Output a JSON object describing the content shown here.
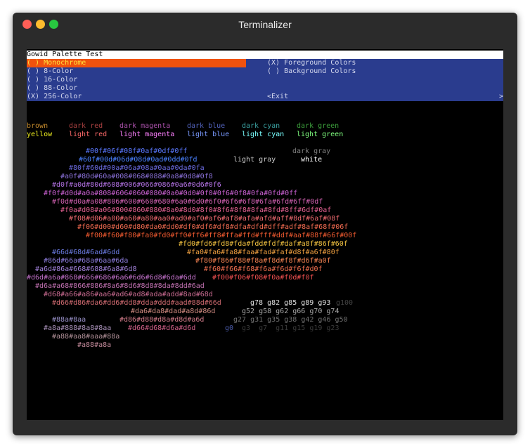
{
  "window": {
    "title": "Terminalizer"
  },
  "header": {
    "title": "Gowid Palette Test"
  },
  "radios_left": [
    {
      "text": "( ) Monochrome",
      "selected": true
    },
    {
      "text": "( ) 8-Color",
      "selected": false
    },
    {
      "text": "( ) 16-Color",
      "selected": false
    },
    {
      "text": "( ) 88-Color",
      "selected": false
    },
    {
      "text": "(X) 256-Color",
      "selected": false
    }
  ],
  "radios_right": [
    {
      "text": "(X) Foreground Colors"
    },
    {
      "text": "( ) Background Colors"
    }
  ],
  "exit_label": "<Exit",
  "scroll_indicator": ">",
  "named_colors": {
    "row1": [
      {
        "text": "brown",
        "color": "#c48a2c"
      },
      {
        "text": "dark red",
        "color": "#a84040"
      },
      {
        "text": "dark magenta",
        "color": "#a850a8"
      },
      {
        "text": "dark blue",
        "color": "#5060b8"
      },
      {
        "text": "dark cyan",
        "color": "#3aa0a0"
      },
      {
        "text": "dark green",
        "color": "#3a9a3a"
      }
    ],
    "row2": [
      {
        "text": "yellow",
        "color": "#f0f020"
      },
      {
        "text": "light red",
        "color": "#ff6a6a"
      },
      {
        "text": "light magenta",
        "color": "#ff80ff"
      },
      {
        "text": "light blue",
        "color": "#7a9aff"
      },
      {
        "text": "light cyan",
        "color": "#7affff"
      },
      {
        "text": "light green",
        "color": "#80ff80"
      }
    ],
    "gray_labels": [
      {
        "text": "dark gray",
        "color": "#808080"
      },
      {
        "text": "light gray",
        "color": "#c8c8c8"
      },
      {
        "text": "white",
        "color": "#ffffff"
      }
    ]
  },
  "palette_lines": [
    {
      "text": "#00f#06f#08f#0af#0df#0ff",
      "color": "#5a78ff"
    },
    {
      "text": "#60f#00d#06d#08d#0ad#0dd#0fd",
      "color": "#4a80ff"
    },
    {
      "text": "#80f#60d#00a#06a#08a#0aa#0da#0fa",
      "color": "#6a6ae0"
    },
    {
      "text": "#a0f#80d#60a#008#068#088#0a8#0d8#0f8",
      "color": "#8a70d8"
    },
    {
      "text": "#d0f#a0d#80d#608#006#066#086#0a6#0d6#0f6",
      "color": "#b070e0"
    },
    {
      "text": "#f0f#d0d#a0a#808#606#060#080#0a0#0d0#0f0#0f6#0f8#0fa#0fd#0ff",
      "color": "#c860d0"
    },
    {
      "text": "#f0d#d0a#a08#806#600#660#680#6a0#6d0#6f0#6f6#6f8#6fa#6fd#6ff#0df",
      "color": "#d060b0"
    },
    {
      "text": "#f0a#d08#a06#800#860#880#8a0#8d0#8f0#8f6#8f8#8fa#8fd#8ff#6df#0af",
      "color": "#e06090"
    },
    {
      "text": "#f08#d06#a00#a60#a80#aa0#ad0#af0#af6#af8#afa#afd#aff#8df#6af#08f",
      "color": "#f06a70"
    },
    {
      "text": "#f06#d00#d60#d80#da0#dd0#df0#df6#df8#dfa#dfd#dff#adf#8af#68f#06f",
      "color": "#f06a50"
    },
    {
      "text": "#f00#f60#f80#fa0#fd0#ff0#ff6#ff8#ffa#ffd#fff#ddf#aaf#88f#66f#00f",
      "color": "#f05a30"
    },
    {
      "text": "#fd0#fd6#fd8#fda#fdd#fdf#daf#a8f#86f#60f",
      "color": "#f0c040"
    },
    {
      "text": "#66d#68d#6ad#6dd",
      "color": "#6a7ae0"
    },
    {
      "text": "#fa0#fa6#fa8#faa#fad#faf#d8f#a6f#80f",
      "color": "#f0a040"
    },
    {
      "text": "#86d#66a#68a#6aa#6da",
      "color": "#8a7ad8"
    },
    {
      "text": "#f80#f86#f88#f8a#f8d#f8f#d6f#a0f",
      "color": "#f08050"
    },
    {
      "text": "#a6d#86a#668#688#6a8#6d8",
      "color": "#a080d8"
    },
    {
      "text": "#f60#f66#f68#f6a#f6d#f6f#d0f",
      "color": "#f07050"
    },
    {
      "text": "#d6d#a6a#868#666#686#6a6#6d6#6d8#6da#6dd",
      "color": "#c070c8"
    },
    {
      "text": "#f00#f06#f08#f0a#f0d#f0f",
      "color": "#f05050"
    },
    {
      "text": "#d6a#a68#866#886#8a6#8d6#8d8#8da#8dd#6ad",
      "color": "#c070b0"
    },
    {
      "text": "#d68#a66#a86#aa6#ad6#ad8#ada#add#8ad#68d",
      "color": "#c86a90"
    },
    {
      "text": "#d66#d86#da6#dd6#dd8#dda#ddd#aad#88d#66d",
      "color": "#d06a70"
    },
    {
      "text": "#da6#da8#dad#a8d#86d",
      "color": "#d08a80"
    },
    {
      "text": "#88a#8aa",
      "color": "#9890c8"
    },
    {
      "text": "#d86#d88#d8a#d8d#a6d",
      "color": "#d07a88"
    },
    {
      "text": "#a8a#888#8a8#8aa",
      "color": "#a890b8"
    },
    {
      "text": "#d66#d68#d6a#d6d",
      "color": "#d06088"
    },
    {
      "text": "#a88#aa8#aaa#88a",
      "color": "#b09098"
    },
    {
      "text": "#a88#a8a",
      "color": "#c08898"
    }
  ],
  "gray_lines": [
    {
      "text": "g78 g82 g85 g89 g93",
      "color": "#e0e0e0"
    },
    {
      "text": "g100",
      "color": "#444444"
    },
    {
      "text": "g52 g58 g62 g66 g70 g74",
      "color": "#a8a8a8"
    },
    {
      "text": "g27 g31 g35 g38 g42 g46 g50",
      "color": "#707070"
    },
    {
      "text": "g0",
      "color": "#4a5aa8"
    },
    {
      "text": "g3  g7  g11 g15 g19 g23",
      "color": "#3a3a3a"
    }
  ]
}
